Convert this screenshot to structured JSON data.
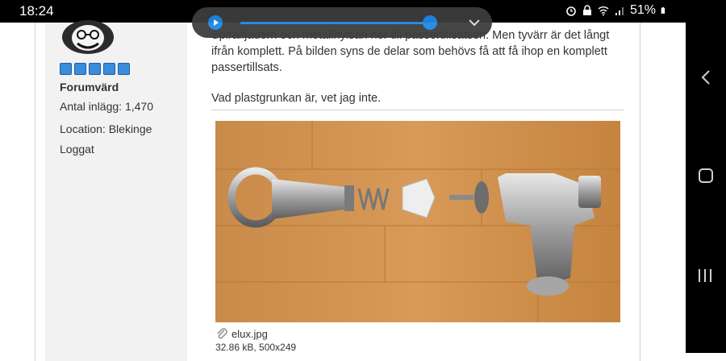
{
  "status_bar": {
    "time": "18:24",
    "battery": "51%"
  },
  "media": {
    "progress": 0.97
  },
  "sidebar": {
    "rank": "Forumvärd",
    "posts": "Antal inlägg: 1,470",
    "location": "Location: Blekinge",
    "status": "Loggat"
  },
  "post": {
    "paragraph": "Spiralfjädern och metallhylsan hör till passertillsatsen. Men tyvärr är det långt ifrån komplett. På bilden syns de delar som behövs få att få ihop en komplett passertillsats.",
    "question": "Vad plastgrunkan är, vet jag inte.",
    "attachment_name": "elux.jpg",
    "attachment_info": "32.86 kB, 500x249"
  },
  "colors": {
    "accent": "#1e88e5",
    "star": "#3a8ddb",
    "sidebar_bg": "#f2f2f2"
  }
}
